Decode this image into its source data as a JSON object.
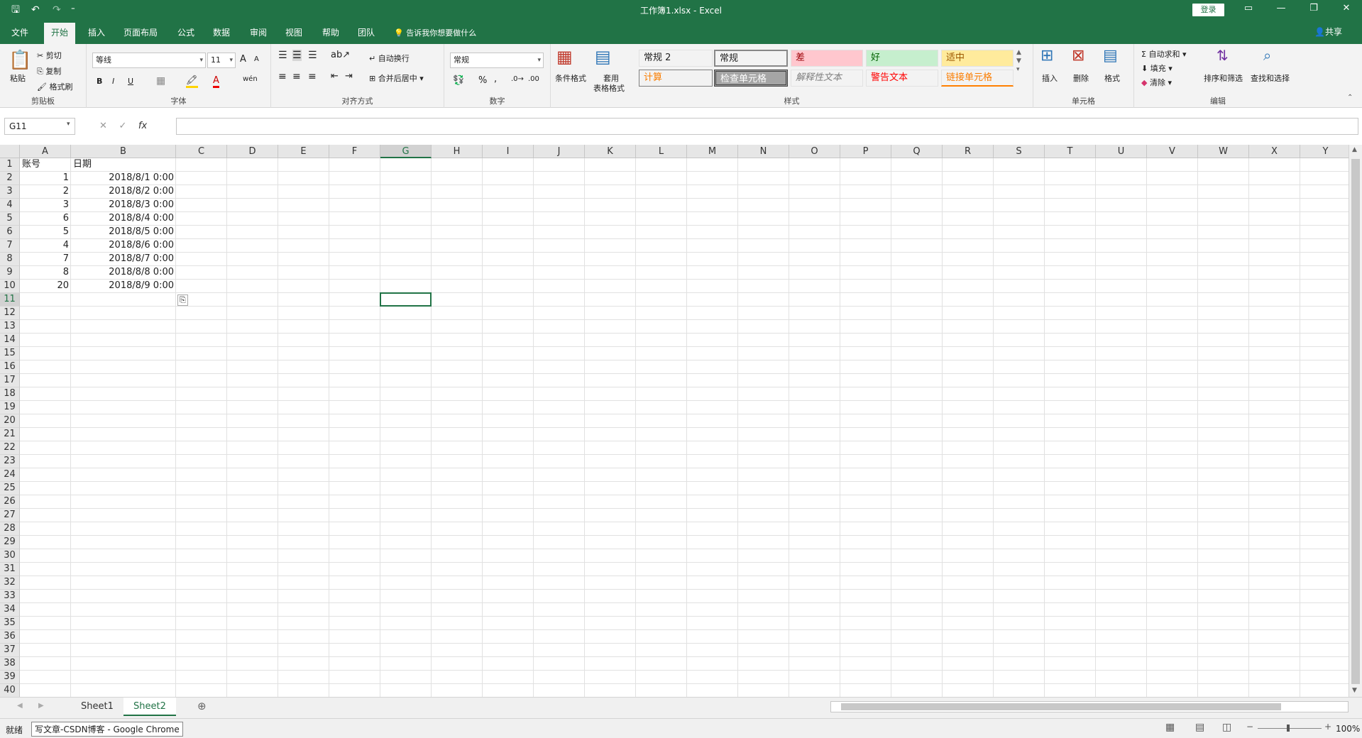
{
  "window": {
    "title": "工作簿1.xlsx  -  Excel",
    "login_label": "登录",
    "share_label": "共享"
  },
  "quick_access": {
    "save": "🖫",
    "undo": "↶",
    "redo": "↷",
    "customize": "⁼"
  },
  "tabs": [
    "文件",
    "开始",
    "插入",
    "页面布局",
    "公式",
    "数据",
    "审阅",
    "视图",
    "帮助",
    "团队"
  ],
  "tell_me": "告诉我你想要做什么",
  "ribbon": {
    "clipboard": {
      "paste": "粘贴",
      "cut": "剪切",
      "copy": "复制",
      "format_painter": "格式刷",
      "label": "剪贴板"
    },
    "font": {
      "name": "等线",
      "size": "11",
      "grow": "A",
      "shrink": "A",
      "bold": "B",
      "italic": "I",
      "underline": "U",
      "label": "字体"
    },
    "alignment": {
      "wrap": "自动换行",
      "merge": "合并后居中",
      "label": "对齐方式"
    },
    "number": {
      "format": "常规",
      "percent": "%",
      "comma": ",",
      "label": "数字"
    },
    "styles": {
      "cond_format": "条件格式",
      "table_format_1": "套用",
      "table_format_2": "表格格式",
      "label": "样式",
      "cells": [
        {
          "text": "常规 2",
          "bg": "#ffffff",
          "fg": "#000000"
        },
        {
          "text": "常规",
          "bg": "#ffffff",
          "fg": "#000000"
        },
        {
          "text": "差",
          "bg": "#ffc7ce",
          "fg": "#9c0006"
        },
        {
          "text": "好",
          "bg": "#c6efce",
          "fg": "#006100"
        },
        {
          "text": "适中",
          "bg": "#ffeb9c",
          "fg": "#9c5700"
        },
        {
          "text": "计算",
          "bg": "#f2f2f2",
          "fg": "#fa7d00"
        },
        {
          "text": "检查单元格",
          "bg": "#a5a5a5",
          "fg": "#ffffff"
        },
        {
          "text": "解释性文本",
          "bg": "#ffffff",
          "fg": "#7f7f7f"
        },
        {
          "text": "警告文本",
          "bg": "#ffffff",
          "fg": "#ff0000"
        },
        {
          "text": "链接单元格",
          "bg": "#ffffff",
          "fg": "#fa7d00"
        }
      ]
    },
    "cells": {
      "insert": "插入",
      "delete": "删除",
      "format": "格式",
      "label": "单元格"
    },
    "editing": {
      "autosum": "自动求和",
      "fill": "填充",
      "clear": "清除",
      "sort": "排序和筛选",
      "find": "查找和选择",
      "label": "编辑"
    }
  },
  "formula_bar": {
    "name_box": "G11",
    "fx": "fx",
    "cancel": "✕",
    "enter": "✓",
    "content": ""
  },
  "columns": [
    "A",
    "B",
    "C",
    "D",
    "E",
    "F",
    "G",
    "H",
    "I",
    "J",
    "K",
    "L",
    "M",
    "N",
    "O",
    "P",
    "Q",
    "R",
    "S",
    "T",
    "U",
    "V",
    "W",
    "X",
    "Y"
  ],
  "selected_column": "G",
  "selected_row": 11,
  "sheet": {
    "header": [
      "账号",
      "日期"
    ],
    "rows": [
      [
        "1",
        "2018/8/1  0:00"
      ],
      [
        "2",
        "2018/8/2  0:00"
      ],
      [
        "3",
        "2018/8/3  0:00"
      ],
      [
        "6",
        "2018/8/4  0:00"
      ],
      [
        "5",
        "2018/8/5  0:00"
      ],
      [
        "4",
        "2018/8/6  0:00"
      ],
      [
        "7",
        "2018/8/7  0:00"
      ],
      [
        "8",
        "2018/8/8  0:00"
      ],
      [
        "20",
        "2018/8/9  0:00"
      ]
    ]
  },
  "sheet_tabs": [
    "Sheet1",
    "Sheet2"
  ],
  "active_sheet": "Sheet2",
  "status": {
    "ready": "就绪",
    "taskbar_tooltip": "写文章-CSDN博客 - Google Chrome",
    "zoom": "100%"
  }
}
